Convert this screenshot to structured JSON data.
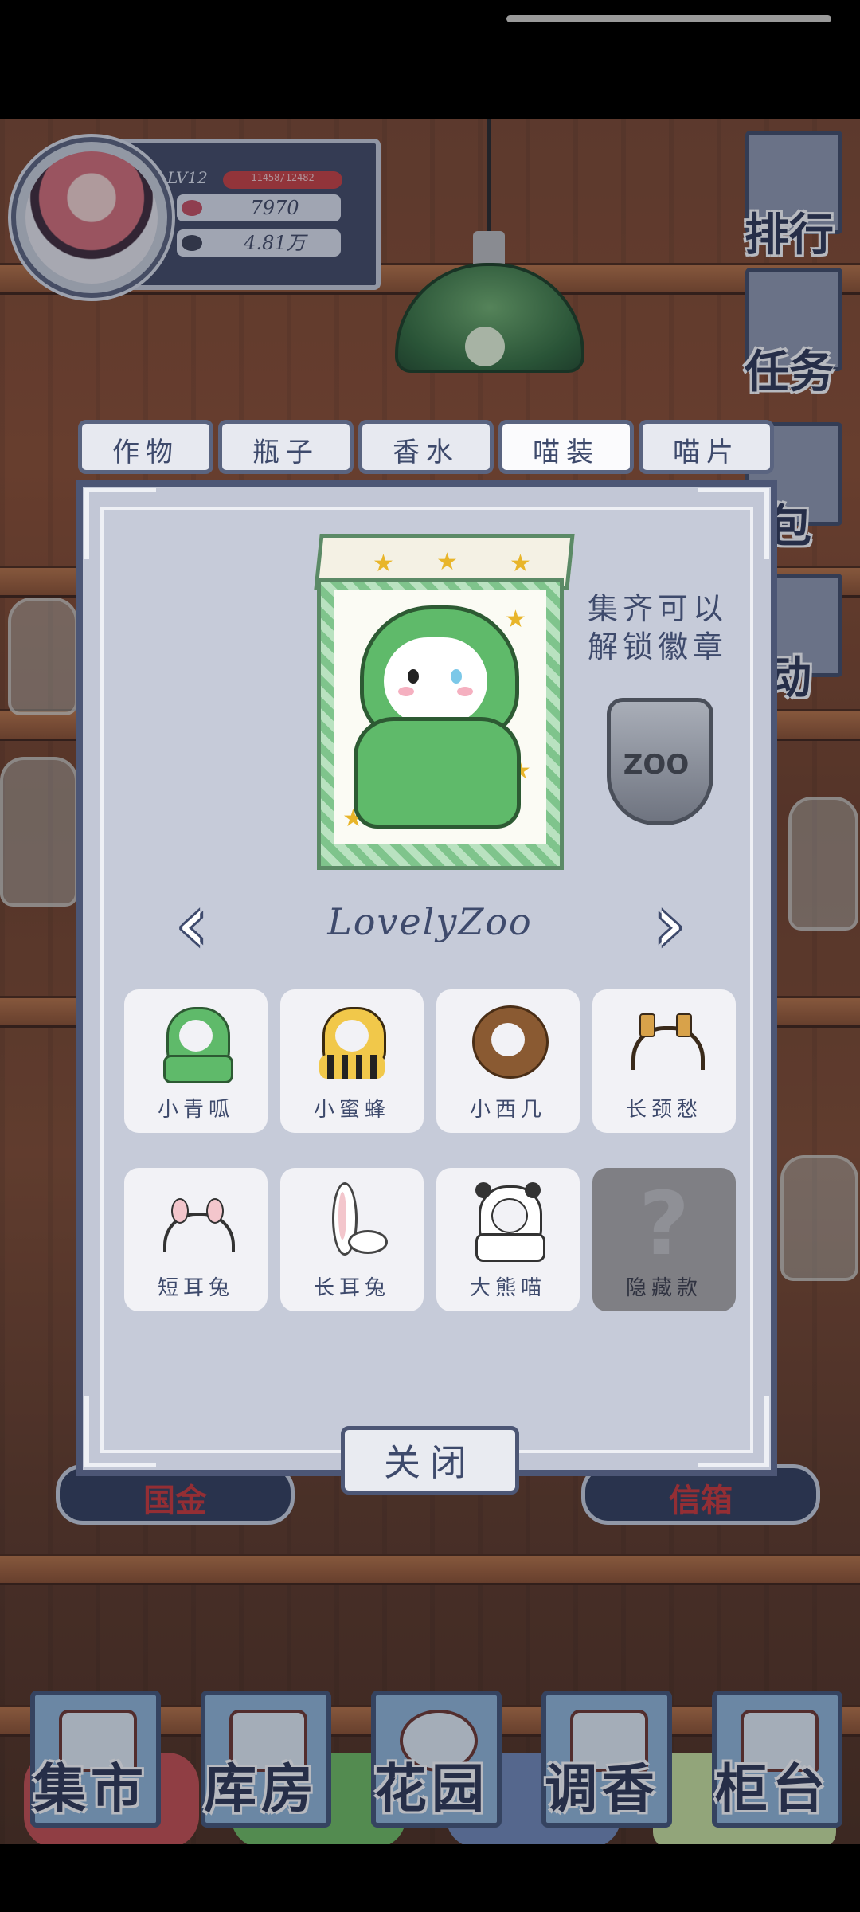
{
  "player": {
    "level": "LV12",
    "exp": "11458/12482",
    "stat1": "7970",
    "stat2": "4.81万"
  },
  "side_buttons": [
    "排行",
    "任务",
    "包",
    "动"
  ],
  "behind_buttons": [
    "国金",
    "信箱"
  ],
  "tabs": [
    "作物",
    "瓶子",
    "香水",
    "喵装",
    "喵片"
  ],
  "active_tab": "喵装",
  "collection": {
    "hint_line1": "集齐可以",
    "hint_line2": "解锁徽章",
    "badge_text": "ZOO",
    "set_name": "LovelyZoo",
    "prev_icon": "chevron-left-icon",
    "next_icon": "chevron-right-icon",
    "items": [
      {
        "name": "小青呱",
        "icon": "frog-hood-icon",
        "color": "#5fba6a"
      },
      {
        "name": "小蜜蜂",
        "icon": "bee-hood-icon",
        "color": "#f1c84a"
      },
      {
        "name": "小西几",
        "icon": "lion-mane-icon",
        "color": "#8a5a32"
      },
      {
        "name": "长颈愁",
        "icon": "giraffe-headband-icon",
        "color": "#7a5236"
      },
      {
        "name": "短耳兔",
        "icon": "bunny-short-ear-headband-icon",
        "color": "#f3c6cc"
      },
      {
        "name": "长耳兔",
        "icon": "bunny-long-ear-icon",
        "color": "#f3c6cc"
      },
      {
        "name": "大熊喵",
        "icon": "panda-hood-icon",
        "color": "#333333"
      },
      {
        "name": "隐藏款",
        "icon": "question-mark-icon",
        "color": "#8f9096"
      }
    ]
  },
  "close_label": "关闭",
  "bottom_nav": [
    "集市",
    "库房",
    "花园",
    "调香",
    "柜台"
  ]
}
